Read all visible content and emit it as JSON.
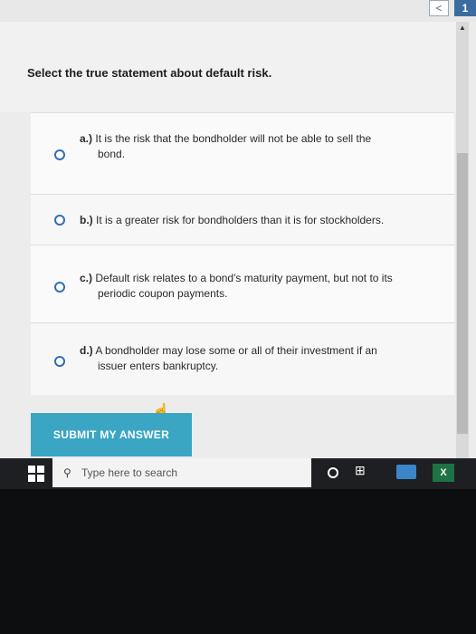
{
  "nav": {
    "prev": "<",
    "page": "1"
  },
  "question": "Select the true statement about default risk.",
  "options": [
    {
      "letter": "a.)",
      "text": "It is the risk that the bondholder will not be able to sell the",
      "cont": "bond."
    },
    {
      "letter": "b.)",
      "text": "It is a greater risk for bondholders than it is for stockholders.",
      "cont": ""
    },
    {
      "letter": "c.)",
      "text": "Default risk relates to a bond's maturity payment, but not to its",
      "cont": "periodic coupon payments."
    },
    {
      "letter": "d.)",
      "text": "A bondholder may lose some or all of their investment if an",
      "cont": "issuer enters bankruptcy."
    }
  ],
  "submit_label": "SUBMIT MY ANSWER",
  "taskbar": {
    "search_placeholder": "Type here to search",
    "excel_label": "X"
  },
  "colors": {
    "accent": "#3aa6c3",
    "radio": "#2f6fb0",
    "taskbar": "#1d1f22"
  },
  "icons": [
    "windows-icon",
    "search-icon",
    "cortana-icon",
    "task-view-icon",
    "file-explorer-icon",
    "excel-icon",
    "hand-cursor-icon"
  ]
}
